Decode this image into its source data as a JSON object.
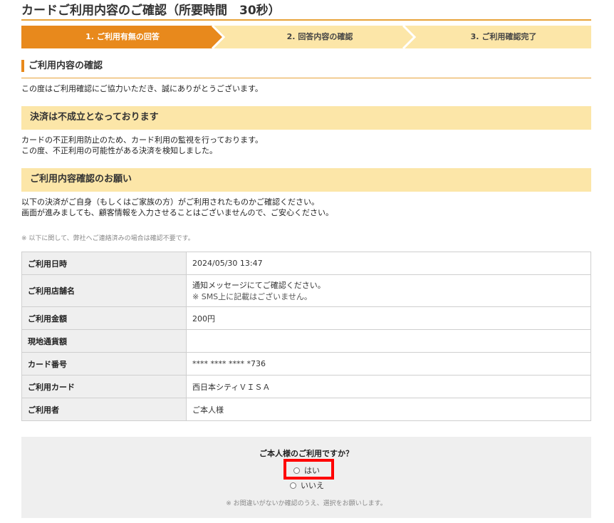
{
  "page": {
    "title": "カードご利用内容のご確認（所要時間　30秒）"
  },
  "steps": [
    {
      "label": "1. ご利用有無の回答",
      "active": true
    },
    {
      "label": "2. 回答内容の確認",
      "active": false
    },
    {
      "label": "3. ご利用確認完了",
      "active": false
    }
  ],
  "section": {
    "title": "ご利用内容の確認",
    "thanks": "この度はご利用確認にご協力いただき、誠にありがとうございます。"
  },
  "band1": {
    "title": "決済は不成立となっております",
    "line1": "カードの不正利用防止のため、カード利用の監視を行っております。",
    "line2": "この度、不正利用の可能性がある決済を検知しました。"
  },
  "band2": {
    "title": "ご利用内容確認のお願い",
    "line1": "以下の決済がご自身（もしくはご家族の方）がご利用されたものかご確認ください。",
    "line2": "画面が進みましても、顧客情報を入力させることはございませんので、ご安心ください。"
  },
  "note": "※ 以下に関して、弊社へご連絡済みの場合は確認不要です。",
  "table": {
    "rows": [
      {
        "label": "ご利用日時",
        "value": "2024/05/30 13:47",
        "sub": ""
      },
      {
        "label": "ご利用店舗名",
        "value": "通知メッセージにてご確認ください。",
        "sub": "※ SMS上に記載はございません。"
      },
      {
        "label": "ご利用金額",
        "value": "200円",
        "sub": ""
      },
      {
        "label": "現地通貨額",
        "value": "",
        "sub": ""
      },
      {
        "label": "カード番号",
        "value": "**** **** **** *736",
        "sub": ""
      },
      {
        "label": "ご利用カード",
        "value": "西日本シティＶＩＳＡ",
        "sub": ""
      },
      {
        "label": "ご利用者",
        "value": "ご本人様",
        "sub": ""
      }
    ]
  },
  "confirm": {
    "question": "ご本人様のご利用ですか？",
    "yes_label": "はい",
    "no_label": "いいえ",
    "note": "※ お間違いがないか確認のうえ、選択をお願いします。"
  },
  "colors": {
    "accent": "#e8891c",
    "step_inactive": "#fce6a8",
    "band": "#fce6a8",
    "highlight": "#ff0000"
  }
}
